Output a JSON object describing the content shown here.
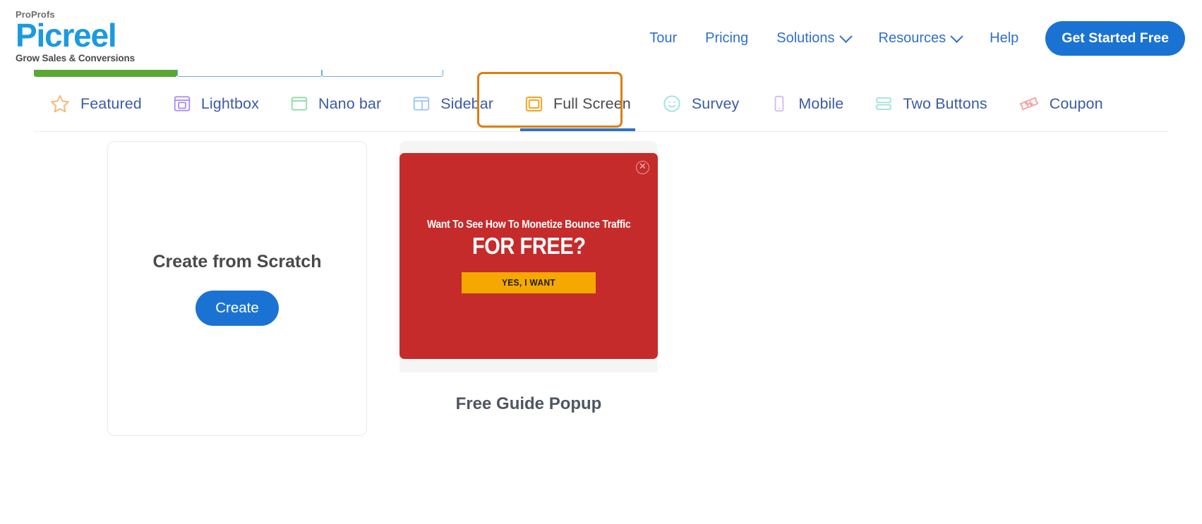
{
  "header": {
    "logo": {
      "pro": "ProProfs",
      "brand": "Picreel",
      "tagline": "Grow Sales & Conversions"
    },
    "nav": [
      {
        "label": "Tour",
        "has_caret": false,
        "name": "nav-link-tour"
      },
      {
        "label": "Pricing",
        "has_caret": false,
        "name": "nav-link-pricing"
      },
      {
        "label": "Solutions",
        "has_caret": true,
        "name": "nav-link-solutions"
      },
      {
        "label": "Resources",
        "has_caret": true,
        "name": "nav-link-resources"
      },
      {
        "label": "Help",
        "has_caret": false,
        "name": "nav-link-help"
      }
    ],
    "cta_label": "Get Started Free"
  },
  "steps": {
    "completed_color": "#5aa832",
    "pending_color": "#6aaee4"
  },
  "tabs": [
    {
      "label": "Featured",
      "icon": "star-icon",
      "color": "#f6b97a",
      "active": false
    },
    {
      "label": "Lightbox",
      "icon": "lightbox-icon",
      "color": "#a78bf5",
      "active": false
    },
    {
      "label": "Nano bar",
      "icon": "nano-bar-icon",
      "color": "#8fdca8",
      "active": false
    },
    {
      "label": "Sidebar",
      "icon": "sidebar-icon",
      "color": "#9cc6f2",
      "active": false
    },
    {
      "label": "Full Screen",
      "icon": "full-screen-icon",
      "color": "#f5a623",
      "active": true
    },
    {
      "label": "Survey",
      "icon": "survey-smiley-icon",
      "color": "#9fe0e8",
      "active": false
    },
    {
      "label": "Mobile",
      "icon": "mobile-icon",
      "color": "#d3b6f0",
      "active": false
    },
    {
      "label": "Two Buttons",
      "icon": "two-buttons-icon",
      "color": "#9fe0d8",
      "active": false
    },
    {
      "label": "Coupon",
      "icon": "coupon-icon",
      "color": "#f2a3a3",
      "active": false
    }
  ],
  "active_tab_highlight_color": "#dd7e12",
  "scratch_card": {
    "title": "Create from Scratch",
    "button_label": "Create"
  },
  "template_card": {
    "name": "Free Guide Popup",
    "popup": {
      "kicker": "Want To See How To Monetize Bounce Traffic",
      "headline": "FOR FREE?",
      "cta_label": "YES, I WANT",
      "background_color": "#c62b2b",
      "cta_color": "#f5a800",
      "close_icon": "close-circle-icon"
    }
  }
}
